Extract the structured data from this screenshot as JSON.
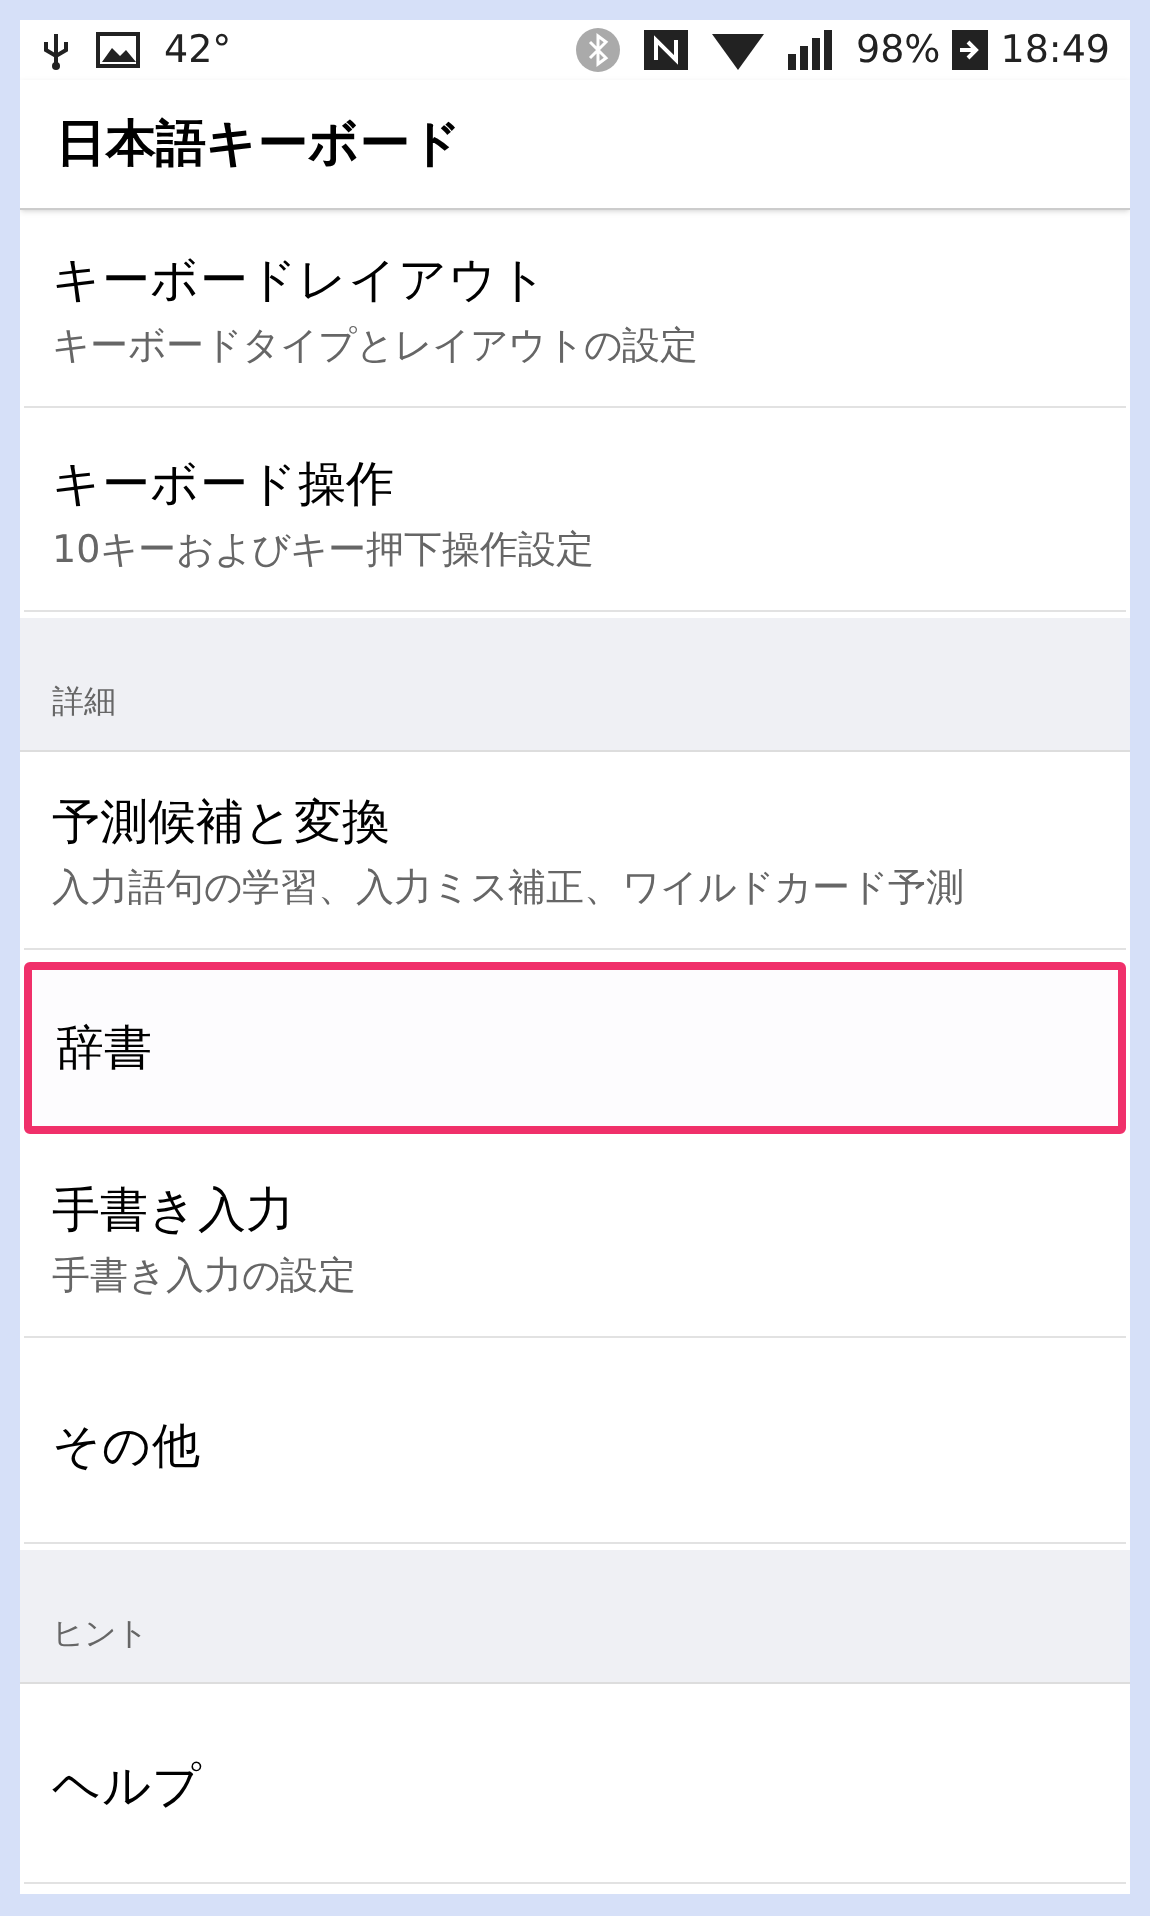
{
  "status_bar": {
    "temperature": "42°",
    "battery": "98%",
    "time": "18:49"
  },
  "app_bar": {
    "title": "日本語キーボード"
  },
  "items": [
    {
      "kind": "item",
      "title": "キーボードレイアウト",
      "summary": "キーボードタイプとレイアウトの設定",
      "highlighted": false
    },
    {
      "kind": "item",
      "title": "キーボード操作",
      "summary": "10キーおよびキー押下操作設定",
      "highlighted": false
    },
    {
      "kind": "header",
      "title": "詳細"
    },
    {
      "kind": "item",
      "title": "予測候補と変換",
      "summary": "入力語句の学習、入力ミス補正、ワイルドカード予測",
      "highlighted": false
    },
    {
      "kind": "item",
      "title": "辞書",
      "highlighted": true
    },
    {
      "kind": "item",
      "title": "手書き入力",
      "summary": "手書き入力の設定",
      "highlighted": false
    },
    {
      "kind": "item",
      "title": "その他",
      "highlighted": false
    },
    {
      "kind": "header",
      "title": "ヒント"
    },
    {
      "kind": "item",
      "title": "ヘルプ",
      "highlighted": false
    }
  ]
}
